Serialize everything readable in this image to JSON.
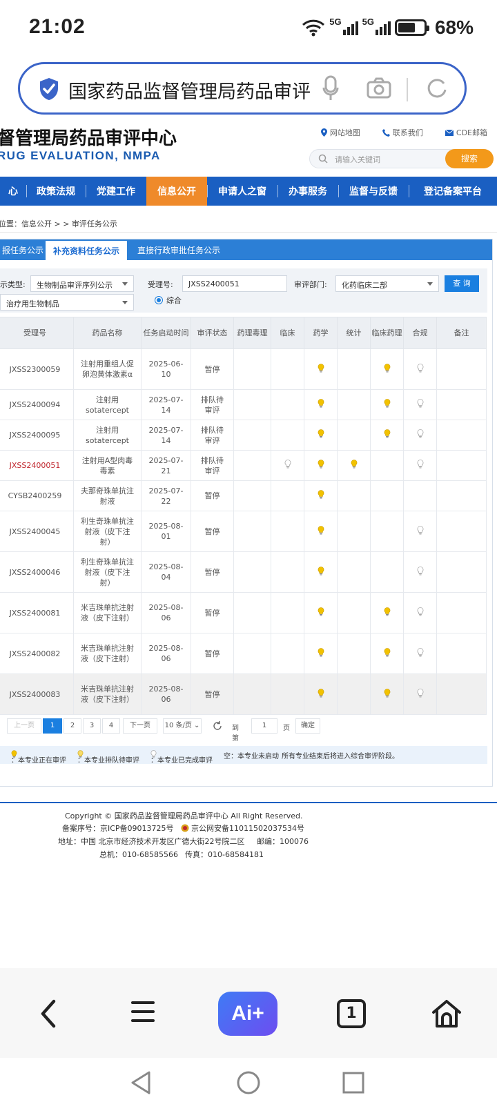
{
  "status_bar": {
    "time": "21:02",
    "net1": "5G",
    "net2": "5G",
    "battery": "68%"
  },
  "browser_search": {
    "text": "国家药品监督管理局药品审评"
  },
  "site": {
    "title": "督管理局药品审评中心",
    "subtitle": "RUG EVALUATION, NMPA",
    "links": [
      "网站地图",
      "联系我们",
      "CDE邮箱"
    ],
    "search_placeholder": "请输入关键词",
    "search_button": "搜索"
  },
  "nav": {
    "items": [
      "心",
      "政策法规",
      "党建工作",
      "信息公开",
      "申请人之窗",
      "办事服务",
      "监督与反馈",
      "登记备案平台"
    ],
    "active": "信息公开"
  },
  "breadcrumb": "位置：信息公开 > > 审评任务公示",
  "tabs": {
    "items": [
      "报任务公示",
      "补充资料任务公示",
      "直接行政审批任务公示"
    ],
    "active": "补充资料任务公示"
  },
  "filters": {
    "type_label": "示类型:",
    "type_value": "生物制品审评序列公示",
    "sub_value": "治疗用生物制品",
    "accept_label": "受理号:",
    "accept_value": "JXSS2400051",
    "dept_label": "审评部门:",
    "dept_value": "化药临床二部",
    "query_button": "查 询",
    "radio_label": "综合"
  },
  "table": {
    "headers": [
      "受理号",
      "药品名称",
      "任务启动时间",
      "审评状态",
      "药理毒理",
      "临床",
      "药学",
      "统计",
      "临床药理",
      "合规",
      "备注"
    ],
    "rows": [
      {
        "id": "JXSS2300059",
        "name": "注射用重组人促卵泡黄体激素α",
        "date": "2025-06-10",
        "status": "暂停",
        "marks": [
          "",
          "",
          "yellow",
          "",
          "yellow",
          "gray"
        ],
        "highlight": false
      },
      {
        "id": "JXSS2400094",
        "name": "注射用sotatercept",
        "date": "2025-07-14",
        "status": "排队待审评",
        "marks": [
          "",
          "",
          "yellow",
          "",
          "yellow",
          "gray"
        ],
        "highlight": false
      },
      {
        "id": "JXSS2400095",
        "name": "注射用sotatercept",
        "date": "2025-07-14",
        "status": "排队待审评",
        "marks": [
          "",
          "",
          "yellow",
          "",
          "yellow",
          "gray"
        ],
        "highlight": false
      },
      {
        "id": "JXSS2400051",
        "name": "注射用A型肉毒毒素",
        "date": "2025-07-21",
        "status": "排队待审评",
        "marks": [
          "",
          "gray",
          "yellow",
          "yellow",
          "",
          "gray"
        ],
        "highlight": false,
        "red": true
      },
      {
        "id": "CYSB2400259",
        "name": "夫那奇珠单抗注射液",
        "date": "2025-07-22",
        "status": "暂停",
        "marks": [
          "",
          "",
          "yellow",
          "",
          "",
          ""
        ],
        "highlight": false
      },
      {
        "id": "JXSS2400045",
        "name": "利生奇珠单抗注射液（皮下注射）",
        "date": "2025-08-01",
        "status": "暂停",
        "marks": [
          "",
          "",
          "yellow",
          "",
          "",
          "gray"
        ],
        "highlight": false
      },
      {
        "id": "JXSS2400046",
        "name": "利生奇珠单抗注射液（皮下注射）",
        "date": "2025-08-04",
        "status": "暂停",
        "marks": [
          "",
          "",
          "yellow",
          "",
          "",
          "gray"
        ],
        "highlight": false
      },
      {
        "id": "JXSS2400081",
        "name": "米吉珠单抗注射液（皮下注射）",
        "date": "2025-08-06",
        "status": "暂停",
        "marks": [
          "",
          "",
          "yellow",
          "",
          "yellow",
          "gray"
        ],
        "highlight": false
      },
      {
        "id": "JXSS2400082",
        "name": "米吉珠单抗注射液（皮下注射）",
        "date": "2025-08-06",
        "status": "暂停",
        "marks": [
          "",
          "",
          "yellow",
          "",
          "yellow",
          "gray"
        ],
        "highlight": false
      },
      {
        "id": "JXSS2400083",
        "name": "米吉珠单抗注射液（皮下注射）",
        "date": "2025-08-06",
        "status": "暂停",
        "marks": [
          "",
          "",
          "yellow",
          "",
          "yellow",
          "gray"
        ],
        "highlight": true
      }
    ]
  },
  "pager": {
    "prev": "上一页",
    "pages": [
      "1",
      "2",
      "3",
      "4"
    ],
    "current": "1",
    "next": "下一页",
    "per_page": "10 条/页",
    "goto_label": "到第",
    "goto_value": "1",
    "page_suffix": "页",
    "confirm": "确定"
  },
  "legend": {
    "reviewing": "：本专业正在审评",
    "queued": "：本专业排队待审评",
    "done": "：本专业已完成审评",
    "empty": "空：本专业未启动",
    "note": "所有专业结束后将进入综合审评阶段。"
  },
  "footer": {
    "copyright": "Copyright © 国家药品监督管理局药品审评中心   All Right Reserved.",
    "icp": "备案序号：京ICP备09013725号",
    "police": "京公网安备11011502037534号",
    "address": "地址：中国 北京市经济技术开发区广德大街22号院二区",
    "postcode": "邮编：100076",
    "phone": "总机：010-68585566",
    "fax": "传真：010-68584181"
  },
  "browser_nav": {
    "tabs_count": "1",
    "ai_label": "Ai+"
  },
  "colors": {
    "nav_blue": "#1a5fc2",
    "active_orange": "#ef8a2a",
    "reviewing": "#f2c200",
    "done": "#c8c8c8"
  }
}
